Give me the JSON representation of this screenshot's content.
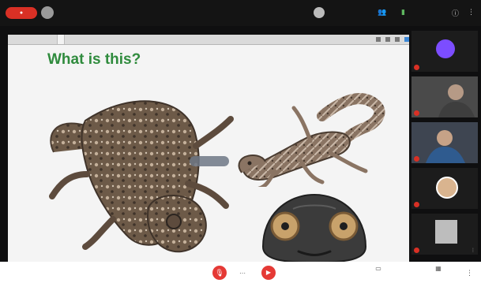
{
  "meeting": {
    "recording_label": "",
    "title": "",
    "footer_title": "",
    "presenter_label": ""
  },
  "topbar": {
    "time": ""
  },
  "share_tabs": [
    "",
    "",
    ""
  ],
  "slide": {
    "title": "What is this?"
  },
  "participants": [
    {
      "name": "",
      "kind": "avatar",
      "avatar_color": "#7c4dff",
      "initials": ""
    },
    {
      "name": "",
      "kind": "video"
    },
    {
      "name": "",
      "kind": "video"
    },
    {
      "name": "",
      "kind": "avatar-photo",
      "avatar_color": "#d9b48f"
    },
    {
      "name": "",
      "kind": "blank"
    }
  ],
  "bottombar": {
    "present_label": "",
    "layout_label": ""
  },
  "colors": {
    "recording_red": "#d93025",
    "slide_title_green": "#2f8b3d",
    "mic_cam_red": "#e53935"
  },
  "icons": {
    "mic": "mic-off-icon",
    "cam": "camera-off-icon",
    "present": "present-screen-icon",
    "layout": "layout-icon",
    "more": "more-vert-icon"
  }
}
